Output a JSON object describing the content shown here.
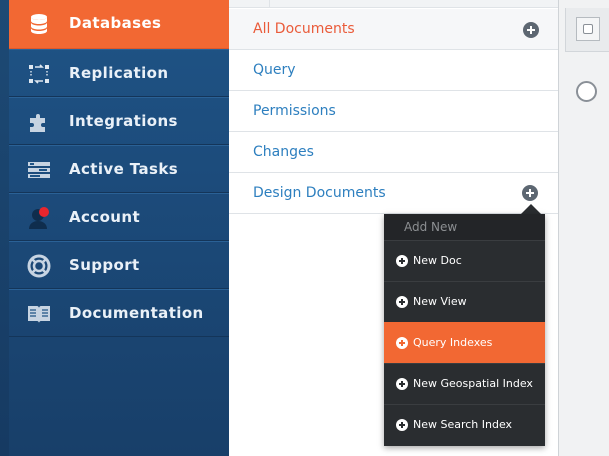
{
  "sidebar": {
    "items": [
      {
        "label": "Databases",
        "icon": "database-icon",
        "active": true
      },
      {
        "label": "Replication",
        "icon": "replication-icon"
      },
      {
        "label": "Integrations",
        "icon": "puzzle-icon"
      },
      {
        "label": "Active Tasks",
        "icon": "tasks-icon"
      },
      {
        "label": "Account",
        "icon": "user-icon"
      },
      {
        "label": "Support",
        "icon": "lifebuoy-icon"
      },
      {
        "label": "Documentation",
        "icon": "book-icon"
      }
    ]
  },
  "docs_nav": {
    "items": [
      {
        "label": "All Documents"
      },
      {
        "label": "Query"
      },
      {
        "label": "Permissions"
      },
      {
        "label": "Changes"
      },
      {
        "label": "Design Documents"
      }
    ]
  },
  "add_new_menu": {
    "header": "Add New",
    "items": [
      {
        "label": "New Doc"
      },
      {
        "label": "New View"
      },
      {
        "label": "Query Indexes",
        "selected": true
      },
      {
        "label": "New Geospatial Index"
      },
      {
        "label": "New Search Index"
      }
    ]
  },
  "colors": {
    "accent": "#f26833",
    "sidebar_blue": "#1f5486",
    "link_blue": "#2d7fbf",
    "menu_dark": "#2a2d30",
    "notification_red": "#e8262d"
  }
}
